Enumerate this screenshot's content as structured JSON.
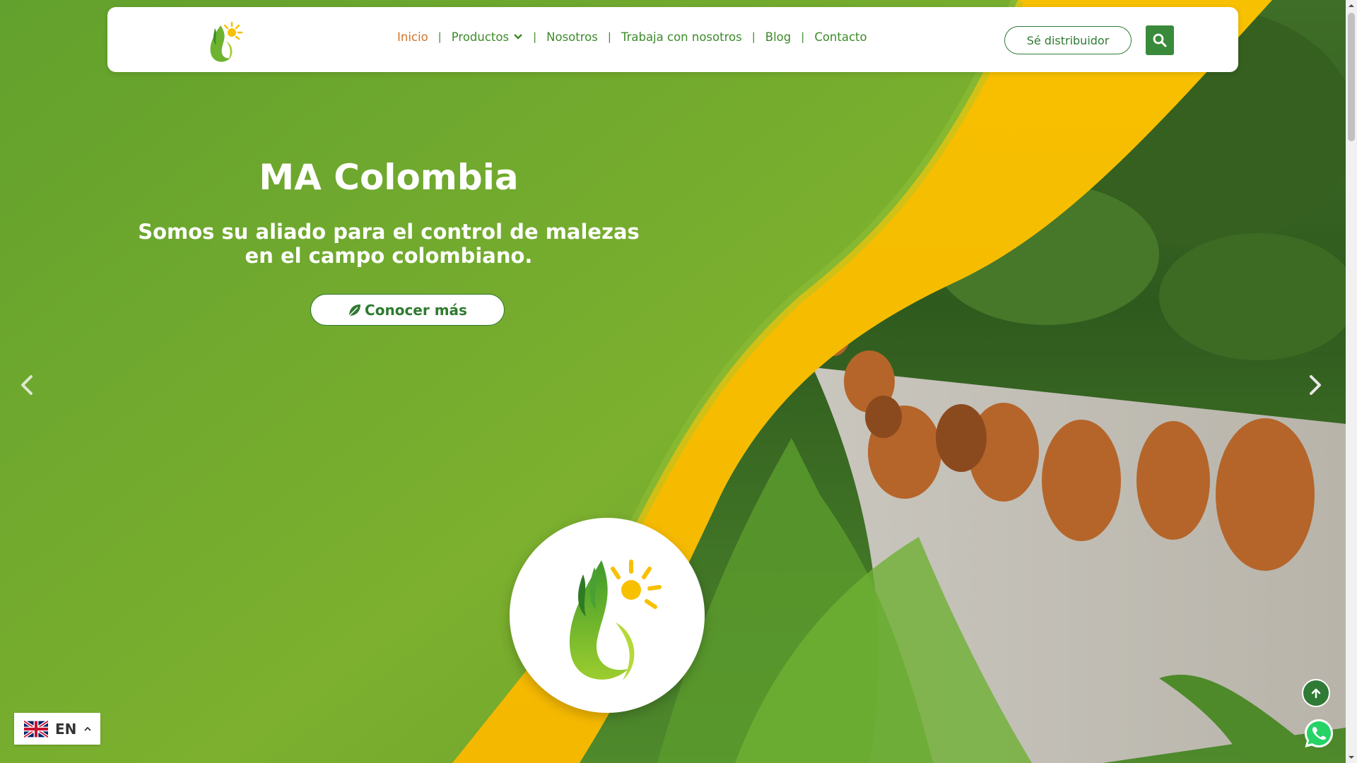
{
  "header": {
    "nav": [
      {
        "label": "Inicio",
        "active": true
      },
      {
        "label": "Productos",
        "dropdown": true
      },
      {
        "label": "Nosotros"
      },
      {
        "label": "Trabaja con nosotros"
      },
      {
        "label": "Blog"
      },
      {
        "label": "Contacto"
      }
    ],
    "distributor_label": "Sé distribuidor",
    "search_icon": "search-icon"
  },
  "hero": {
    "title": "MA Colombia",
    "subtitle": "Somos su aliado para el control de malezas en el campo colombiano.",
    "cta_label": "Conocer más",
    "cta_icon": "leaf-icon"
  },
  "language": {
    "code": "EN",
    "flag": "uk-flag-icon"
  },
  "colors": {
    "brand_green": "#3a8a3c",
    "nav_green": "#3d8b2a",
    "active_orange": "#d2742a",
    "hero_green": "#6aa62e",
    "accent_yellow": "#f7c200"
  }
}
